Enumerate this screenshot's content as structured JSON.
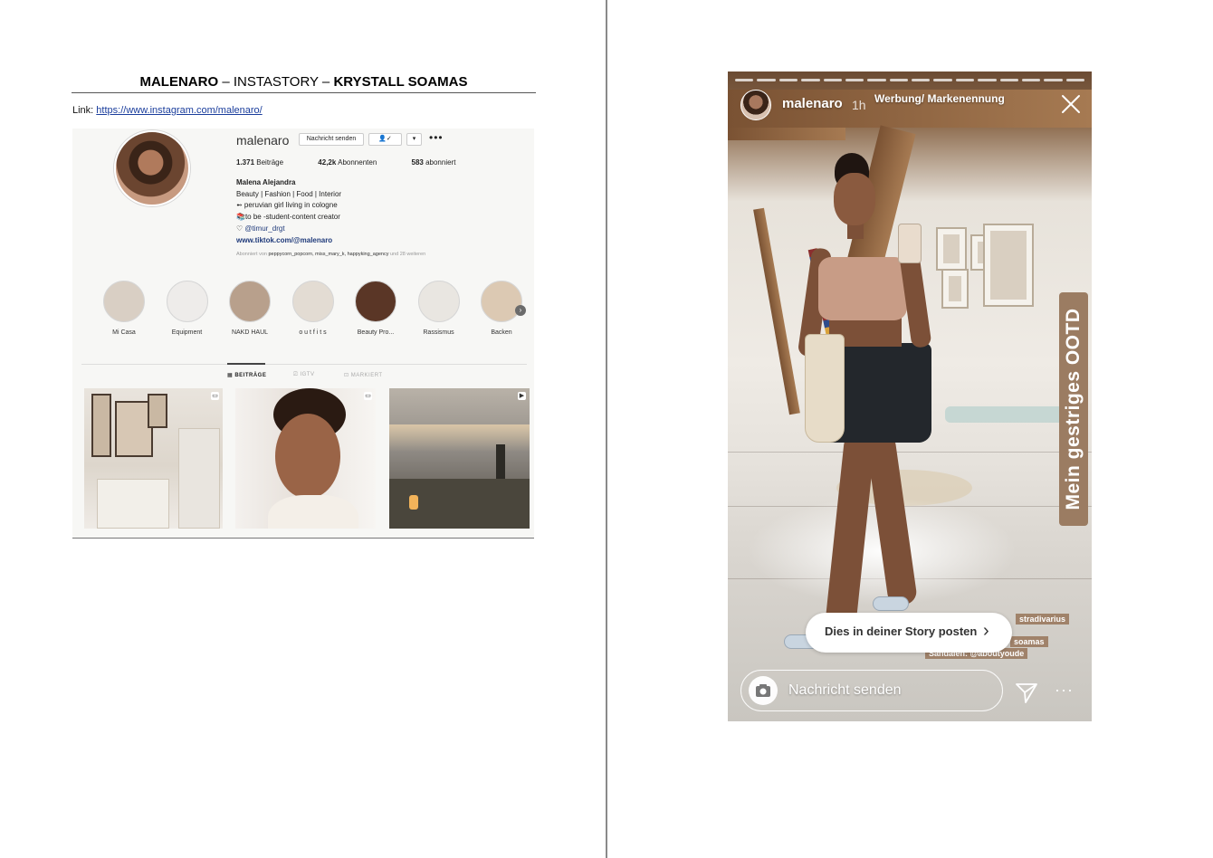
{
  "document": {
    "title_brand": "MALENARO",
    "title_sep_1": " – ",
    "title_type": "INSTASTORY",
    "title_sep_2": " – ",
    "title_client": "KRYSTALL SOAMAS",
    "link_label": "Link: ",
    "link_url": "https://www.instagram.com/malenaro/"
  },
  "profile": {
    "username": "malenaro",
    "message_button": "Nachricht senden",
    "follow_button": "👤✓",
    "dropdown_button": "▾",
    "more_icon": "•••",
    "stats": {
      "posts_value": "1.371",
      "posts_label": " Beiträge",
      "followers_value": "42,2k",
      "followers_label": " Abonnenten",
      "following_value": "583",
      "following_label": " abonniert"
    },
    "bio": {
      "name": "Malena Alejandra",
      "line1": "Beauty | Fashion | Food | Interior",
      "line2": "➻ peruvian girl living in cologne",
      "line3": "📚to be -student-content creator",
      "line4": "♡ ",
      "line4_tag": "@timur_drgt",
      "website": "www.tiktok.com/@malenaro"
    },
    "followed_by_prefix": "Abonniert von ",
    "followed_by_names": "peppycorn_popcorn, miss_mary_k, happyking_agency",
    "followed_by_suffix": " und 28 weiteren",
    "highlights": [
      {
        "label": "Mi Casa",
        "color": "#d9cfc4"
      },
      {
        "label": "Equipment",
        "color": "#eeecea"
      },
      {
        "label": "NAKD HAUL",
        "color": "#b8a08c"
      },
      {
        "label": "o u t f i t s",
        "color": "#e3dcd3"
      },
      {
        "label": "Beauty Pro...",
        "color": "#5a3626"
      },
      {
        "label": "Rassismus",
        "color": "#e9e6e1"
      },
      {
        "label": "Backen",
        "color": "#dcc9b3"
      }
    ],
    "highlights_next_icon": "›",
    "tabs": {
      "posts": "▦ BEITRÄGE",
      "igtv": "⎚ IGTV",
      "tagged": "⊡ MARKIERT"
    }
  },
  "story": {
    "username": "malenaro",
    "time": "1h",
    "paid_label": "Werbung/ Markenennung",
    "sticker_text": "Mein gestriges OOTD",
    "brand_tags": [
      "stradivarius",
      "soamas",
      "Sandalen: @aboutyoude"
    ],
    "share_button": "Dies in deiner Story posten",
    "share_chevron": "›",
    "message_placeholder": "Nachricht senden",
    "more_icon": "···",
    "accent_color": "#9b7c62"
  }
}
